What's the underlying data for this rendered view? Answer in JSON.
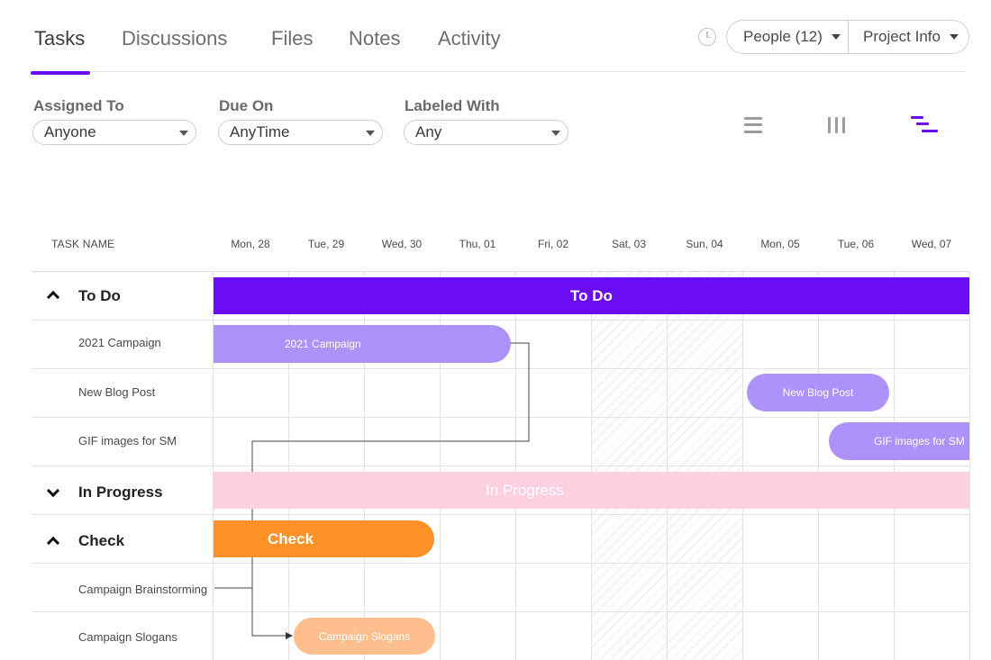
{
  "tabs": [
    {
      "label": "Tasks",
      "active": true
    },
    {
      "label": "Discussions",
      "active": false
    },
    {
      "label": "Files",
      "active": false
    },
    {
      "label": "Notes",
      "active": false
    },
    {
      "label": "Activity",
      "active": false
    }
  ],
  "header": {
    "people_label": "People (12)",
    "project_info_label": "Project Info",
    "history_icon": "clock-icon"
  },
  "filters": {
    "assigned": {
      "label": "Assigned To",
      "value": "Anyone"
    },
    "due": {
      "label": "Due On",
      "value": "AnyTime"
    },
    "labeled": {
      "label": "Labeled With",
      "value": "Any"
    }
  },
  "views": {
    "list_icon": "list-view-icon",
    "board_icon": "board-view-icon",
    "gantt_icon": "gantt-view-icon",
    "active": "gantt"
  },
  "gantt": {
    "task_name_header": "TASK NAME",
    "days": [
      "Mon, 28",
      "Tue, 29",
      "Wed, 30",
      "Thu, 01",
      "Fri, 02",
      "Sat, 03",
      "Sun, 04",
      "Mon, 05",
      "Tue, 06",
      "Wed, 07"
    ],
    "weekend_days": [
      "Sat, 03",
      "Sun, 04"
    ],
    "rows": [
      {
        "type": "group",
        "label": "To Do",
        "expanded": true,
        "bar_label": "To Do",
        "color": "#6a0cf6"
      },
      {
        "type": "task",
        "label": "2021 Campaign",
        "bar_label": "2021 Campaign",
        "color": "#ad92fb"
      },
      {
        "type": "task",
        "label": "New Blog Post",
        "bar_label": "New Blog Post",
        "color": "#ad92fb"
      },
      {
        "type": "task",
        "label": "GIF images for SM",
        "bar_label": "GIF images for SM",
        "color": "#ad92fb"
      },
      {
        "type": "group",
        "label": "In Progress",
        "expanded": false,
        "bar_label": "In Progress",
        "color": "#ffd0df"
      },
      {
        "type": "group",
        "label": "Check",
        "expanded": true,
        "bar_label": "Check",
        "color": "#ff9127"
      },
      {
        "type": "task",
        "label": "Campaign Brainstorming",
        "bar_label": "",
        "color": ""
      },
      {
        "type": "task",
        "label": "Campaign Slogans",
        "bar_label": "Campaign Slogans",
        "color": "#ffbe8e"
      }
    ]
  }
}
